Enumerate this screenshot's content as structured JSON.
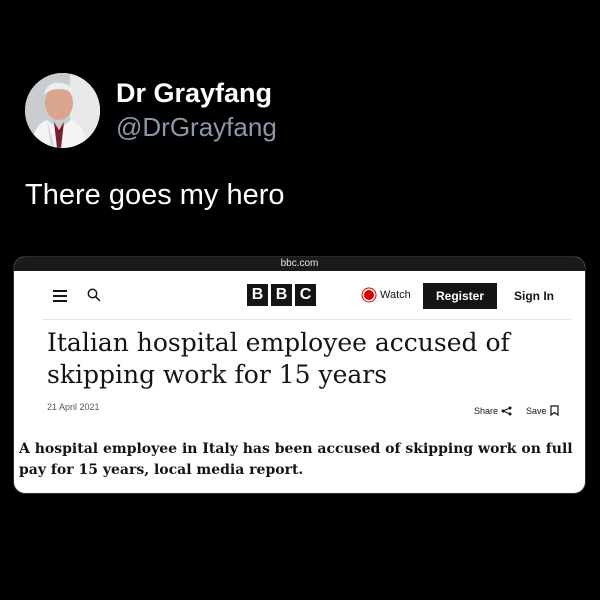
{
  "tweet": {
    "display_name": "Dr Grayfang",
    "handle": "@DrGrayfang",
    "text": "There goes my hero"
  },
  "browser": {
    "url": "bbc.com"
  },
  "bbc_nav": {
    "logo_letters": [
      "B",
      "B",
      "C"
    ],
    "watch_label": "Watch",
    "register_label": "Register",
    "signin_label": "Sign In"
  },
  "article": {
    "headline": "Italian hospital employee accused of skipping work for 15 years",
    "date": "21 April 2021",
    "share_label": "Share",
    "save_label": "Save",
    "summary": "A hospital employee in Italy has been accused of skipping work on full pay for 15 years, local media report."
  },
  "colors": {
    "background": "#000000",
    "handle": "#8b98a5",
    "live_red": "#d40000"
  }
}
